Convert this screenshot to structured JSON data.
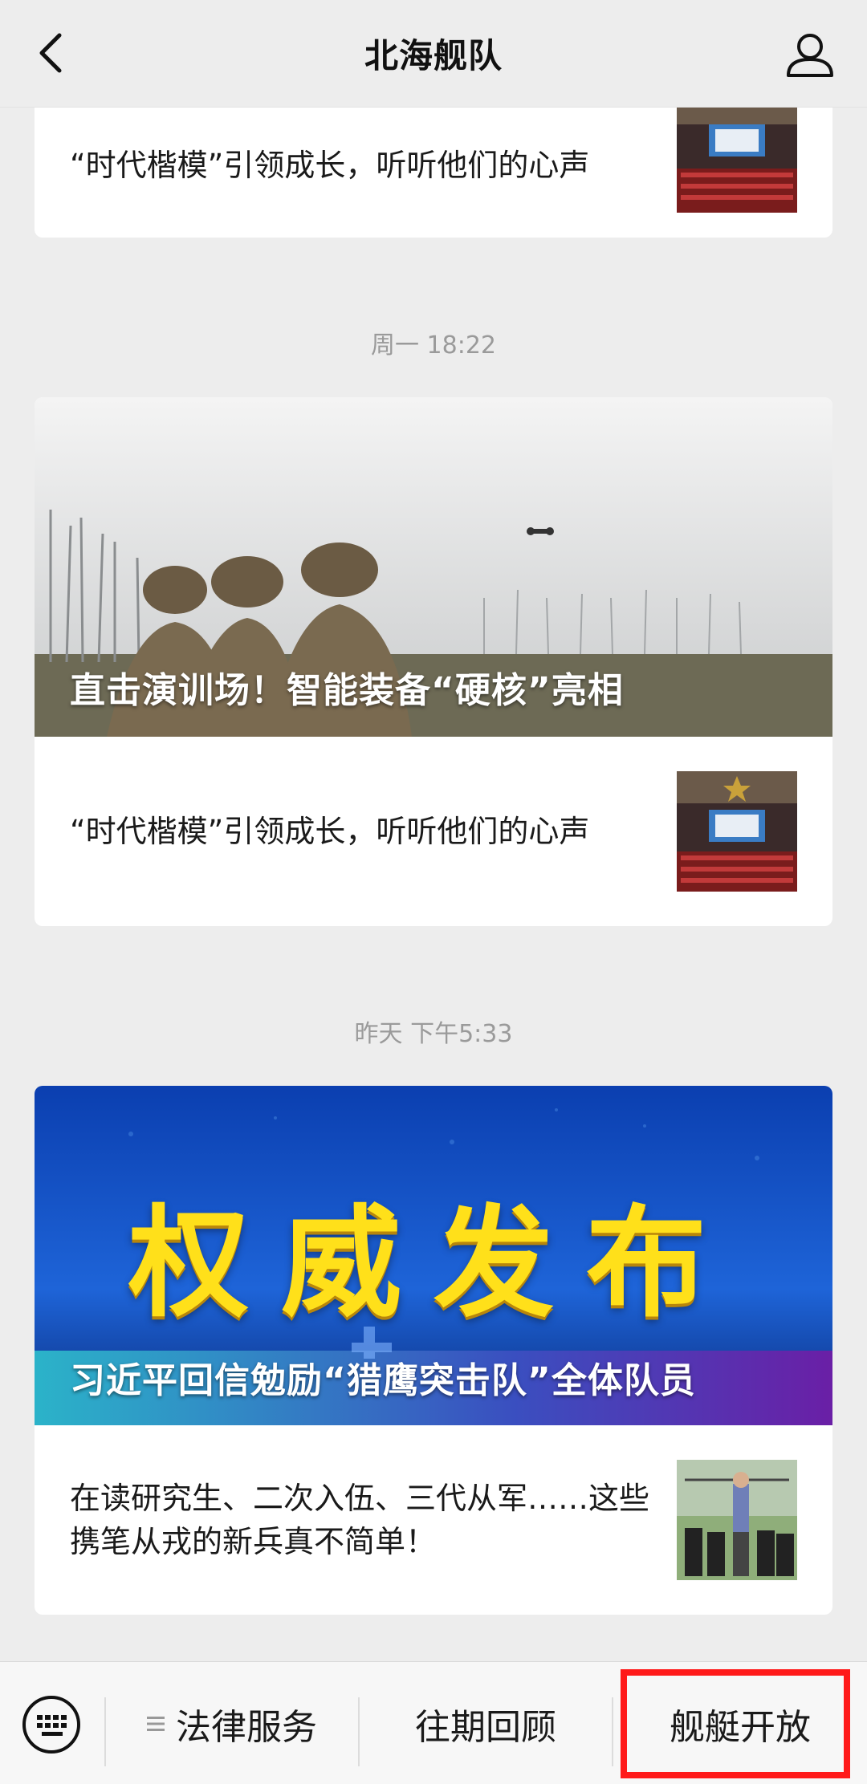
{
  "header": {
    "title": "北海舰队"
  },
  "feed": {
    "card0": {
      "sub_title": "“时代楷模”引领成长，听听他们的心声"
    },
    "timestamp1": "周一 18:22",
    "card1": {
      "hero_title": "直击演训场！智能装备“硬核”亮相",
      "sub_title": "“时代楷模”引领成长，听听他们的心声"
    },
    "timestamp2": "昨天 下午5:33",
    "card2": {
      "banner_text": "权威发布",
      "hero_title": "习近平回信勉励“猎鹰突击队”全体队员",
      "sub_title": "在读研究生、二次入伍、三代从军……这些携笔从戎的新兵真不简单！"
    }
  },
  "menu": {
    "item1": "法律服务",
    "item2": "往期回顾",
    "item3": "舰艇开放"
  },
  "colors": {
    "highlight": "#ff1a1a",
    "background": "#ededed"
  },
  "icons": [
    "back-arrow-icon",
    "profile-icon",
    "keyboard-icon",
    "menu-lines-icon"
  ]
}
